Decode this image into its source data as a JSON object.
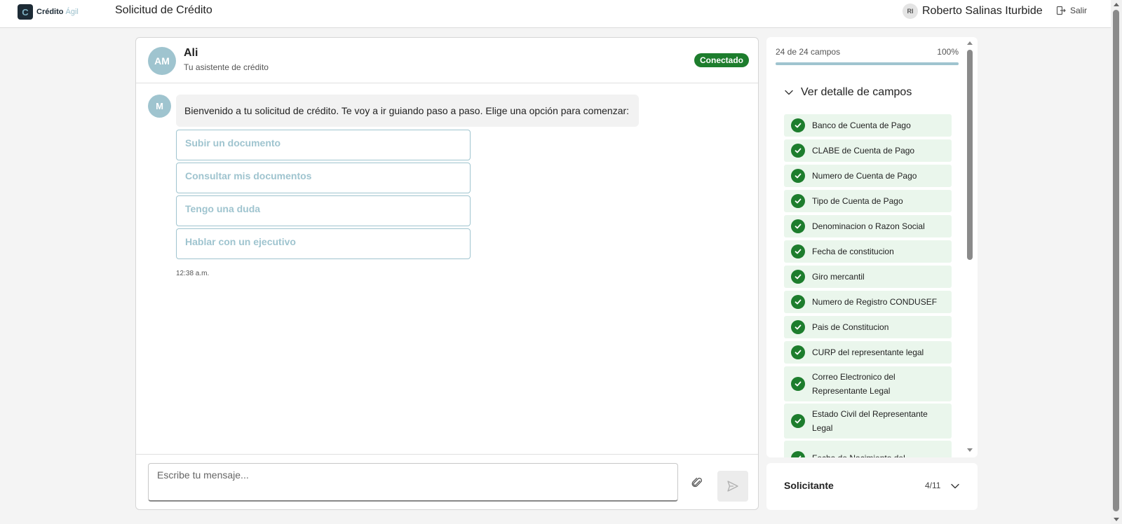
{
  "app": {
    "logo_letter": "C",
    "logo_text": "Crédito",
    "logo_accent": "Ágil",
    "page_title": "Solicitud de Crédito"
  },
  "user": {
    "initials": "RI",
    "name": "Roberto Salinas Iturbide",
    "logout_label": "Salir"
  },
  "chat": {
    "assistant_initials": "AM",
    "assistant_name": "Ali",
    "assistant_subtitle": "Tu asistente de crédito",
    "status": "Conectado",
    "message": {
      "avatar_initial": "M",
      "text": "Bienvenido a tu solicitud de crédito. Te voy a ir guiando paso a paso. Elige una opción para comenzar:",
      "options": [
        "Subir un documento",
        "Consultar mis documentos",
        "Tengo una duda",
        "Hablar con un ejecutivo"
      ],
      "time": "12:38 a.m."
    },
    "input_placeholder": "Escribe tu mensaje..."
  },
  "progress": {
    "label": "24 de 24 campos",
    "percent_label": "100%",
    "fraction": 1.0,
    "detail_toggle": "Ver detalle de campos",
    "fields": [
      "Banco de Cuenta de Pago",
      "CLABE de Cuenta de Pago",
      "Numero de Cuenta de Pago",
      "Tipo de Cuenta de Pago",
      "Denominacion o Razon Social",
      "Fecha de constitucion",
      "Giro mercantil",
      "Numero de Registro CONDUSEF",
      "Pais de Constitucion",
      "CURP del representante legal",
      "Correo Electronico del Representante Legal",
      "Estado Civil del Representante Legal",
      "Fecha de Nacimiento del"
    ]
  },
  "section": {
    "name": "Solicitante",
    "count": "4/11"
  },
  "colors": {
    "accent": "#9fc4cf",
    "success": "#1d7d2d",
    "brand_dark": "#1d2b36"
  }
}
